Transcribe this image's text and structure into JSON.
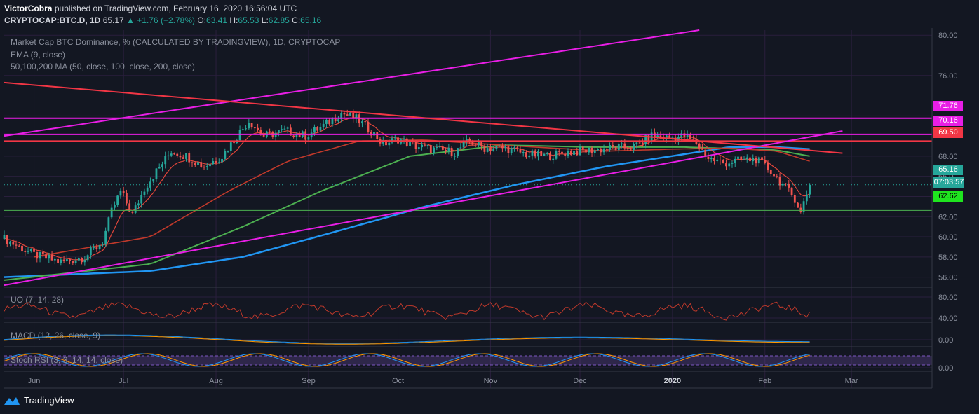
{
  "header": {
    "author": "VictorCobra",
    "published": "published on TradingView.com, February 16, 2020 16:56:04 UTC",
    "symbol": "CRYPTOCAP:BTC.D, 1D",
    "last": "65.17",
    "change": "+1.76 (+2.78%)",
    "o_label": "O:",
    "o": "63.41",
    "h_label": "H:",
    "h": "65.53",
    "l_label": "L:",
    "l": "62.85",
    "c_label": "C:",
    "c": "65.16"
  },
  "legends": {
    "main": "Market Cap BTC Dominance, % (CALCULATED BY TRADINGVIEW), 1D, CRYPTOCAP",
    "ema": "EMA (9, close)",
    "ma": "50,100,200 MA (50, close, 100, close, 200, close)",
    "uo": "UO (7, 14, 28)",
    "macd": "MACD (12, 26, close, 9)",
    "stoch": "Stoch RSI (3, 3, 14, 14, close)"
  },
  "badges": {
    "lvl1": "71.76",
    "lvl2": "70.16",
    "lvl3": "69.50",
    "price": "65.16",
    "countdown": "07:03:57",
    "support": "62.62"
  },
  "colors": {
    "bg": "#131722",
    "grid": "#2a1f3d",
    "up": "#26a69a",
    "down": "#ef5350",
    "magenta": "#e91ee6",
    "red": "#f23645",
    "ema": "#e0453a",
    "ma50": "#c0392b",
    "ma100": "#4caf50",
    "ma200": "#2196f3",
    "support": "#4caf50"
  },
  "footer": {
    "brand": "TradingView"
  },
  "chart_data": {
    "type": "candlestick",
    "x_ticks": [
      "Jun",
      "Jul",
      "Aug",
      "Sep",
      "Oct",
      "Nov",
      "Dec",
      "2020",
      "Feb",
      "Mar"
    ],
    "y_ticks": [
      "80.00",
      "76.00",
      "71.76",
      "70.16",
      "69.50",
      "68.00",
      "66.00",
      "65.16",
      "62.62",
      "62.00",
      "60.00",
      "58.00",
      "56.00"
    ],
    "uo_ticks": [
      "80.00",
      "40.00"
    ],
    "macd_ticks": [
      "0.00"
    ],
    "stoch_ticks": [
      "0.00"
    ],
    "close_path": [
      [
        "2019-05-22",
        59.8
      ],
      [
        "2019-06-01",
        58.2
      ],
      [
        "2019-06-10",
        57.5
      ],
      [
        "2019-06-18",
        58.0
      ],
      [
        "2019-06-24",
        59.5
      ],
      [
        "2019-06-27",
        62.5
      ],
      [
        "2019-06-30",
        64.5
      ],
      [
        "2019-07-04",
        62.2
      ],
      [
        "2019-07-08",
        64.8
      ],
      [
        "2019-07-12",
        66.5
      ],
      [
        "2019-07-17",
        68.5
      ],
      [
        "2019-07-22",
        68.0
      ],
      [
        "2019-07-28",
        67.0
      ],
      [
        "2019-08-03",
        68.0
      ],
      [
        "2019-08-08",
        70.0
      ],
      [
        "2019-08-12",
        71.5
      ],
      [
        "2019-08-17",
        70.0
      ],
      [
        "2019-08-24",
        70.5
      ],
      [
        "2019-08-31",
        70.0
      ],
      [
        "2019-09-06",
        71.0
      ],
      [
        "2019-09-12",
        72.3
      ],
      [
        "2019-09-17",
        71.7
      ],
      [
        "2019-09-22",
        70.5
      ],
      [
        "2019-09-26",
        69.2
      ],
      [
        "2019-10-01",
        69.7
      ],
      [
        "2019-10-07",
        69.0
      ],
      [
        "2019-10-14",
        68.6
      ],
      [
        "2019-10-20",
        68.4
      ],
      [
        "2019-10-25",
        69.5
      ],
      [
        "2019-10-30",
        68.8
      ],
      [
        "2019-11-06",
        68.8
      ],
      [
        "2019-11-13",
        68.2
      ],
      [
        "2019-11-20",
        68.0
      ],
      [
        "2019-11-27",
        68.4
      ],
      [
        "2019-12-05",
        68.6
      ],
      [
        "2019-12-12",
        68.8
      ],
      [
        "2019-12-19",
        68.9
      ],
      [
        "2019-12-25",
        70.0
      ],
      [
        "2019-12-31",
        69.8
      ],
      [
        "2020-01-05",
        70.0
      ],
      [
        "2020-01-09",
        69.3
      ],
      [
        "2020-01-13",
        67.8
      ],
      [
        "2020-01-18",
        67.3
      ],
      [
        "2020-01-24",
        67.6
      ],
      [
        "2020-01-29",
        67.7
      ],
      [
        "2020-02-03",
        66.5
      ],
      [
        "2020-02-07",
        65.2
      ],
      [
        "2020-02-11",
        63.8
      ],
      [
        "2020-02-13",
        62.4
      ],
      [
        "2020-02-14",
        63.41
      ],
      [
        "2020-02-16",
        65.16
      ]
    ],
    "sma50_path": [
      [
        "2019-06-01",
        58.0
      ],
      [
        "2019-07-10",
        60.0
      ],
      [
        "2019-08-05",
        64.5
      ],
      [
        "2019-08-25",
        67.5
      ],
      [
        "2019-09-18",
        69.5
      ],
      [
        "2019-10-10",
        69.6
      ],
      [
        "2019-11-10",
        69.0
      ],
      [
        "2019-12-10",
        68.5
      ],
      [
        "2020-01-01",
        68.7
      ],
      [
        "2020-01-20",
        68.8
      ],
      [
        "2020-02-05",
        68.5
      ],
      [
        "2020-02-16",
        67.5
      ]
    ],
    "sma100_path": [
      [
        "2019-05-22",
        55.7
      ],
      [
        "2019-07-10",
        57.3
      ],
      [
        "2019-08-10",
        61.0
      ],
      [
        "2019-09-05",
        64.5
      ],
      [
        "2019-10-05",
        68.0
      ],
      [
        "2019-11-05",
        69.1
      ],
      [
        "2019-12-05",
        68.9
      ],
      [
        "2020-01-05",
        68.9
      ],
      [
        "2020-02-05",
        68.6
      ],
      [
        "2020-02-16",
        68.0
      ]
    ],
    "sma200_path": [
      [
        "2019-05-22",
        56.0
      ],
      [
        "2019-07-10",
        56.6
      ],
      [
        "2019-08-10",
        58.0
      ],
      [
        "2019-09-10",
        60.5
      ],
      [
        "2019-10-10",
        63.0
      ],
      [
        "2019-11-10",
        65.2
      ],
      [
        "2019-12-10",
        67.0
      ],
      [
        "2020-01-05",
        68.2
      ],
      [
        "2020-01-20",
        68.9
      ],
      [
        "2020-02-05",
        68.9
      ],
      [
        "2020-02-16",
        68.7
      ]
    ],
    "trendlines": [
      {
        "name": "upper channel",
        "from": [
          "2019-05-22",
          70.0
        ],
        "to": [
          "2020-01-10",
          80.5
        ]
      },
      {
        "name": "lower channel",
        "from": [
          "2019-05-22",
          55.2
        ],
        "to": [
          "2020-02-27",
          70.5
        ]
      },
      {
        "name": "descending resistance",
        "from": [
          "2019-05-22",
          75.3
        ],
        "to": [
          "2020-02-27",
          68.3
        ]
      }
    ],
    "horizontal_levels": [
      71.76,
      70.16,
      69.5,
      62.62
    ],
    "ylim": [
      55,
      80.5
    ],
    "xlim": [
      "2019-05-22",
      "2020-03-28"
    ]
  }
}
